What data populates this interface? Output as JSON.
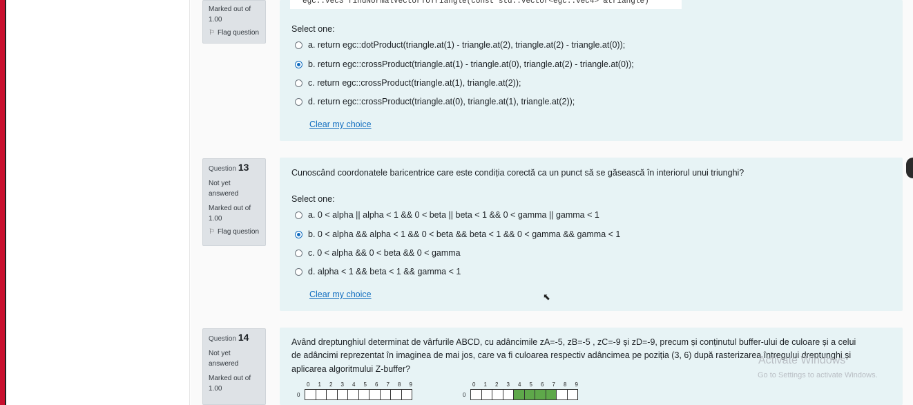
{
  "q12": {
    "marked_label": "Marked out of",
    "marked_value": "1.00",
    "flag_label": "Flag question",
    "code_snippet": "egc::vec3 findNormalVectorToTriangle(const std::vector<egc::vec4> &triangle)",
    "select_one": "Select one:",
    "options": [
      {
        "text": "a. return egc::dotProduct(triangle.at(1) - triangle.at(2), triangle.at(2) - triangle.at(0));",
        "checked": false
      },
      {
        "text": "b. return egc::crossProduct(triangle.at(1) - triangle.at(0), triangle.at(2) - triangle.at(0));",
        "checked": true
      },
      {
        "text": "c. return egc::crossProduct(triangle.at(1), triangle.at(2));",
        "checked": false
      },
      {
        "text": "d. return egc::crossProduct(triangle.at(0), triangle.at(1), triangle.at(2));",
        "checked": false
      }
    ],
    "clear_label": "Clear my choice"
  },
  "q13": {
    "question_word": "Question",
    "number": "13",
    "status_line1": "Not yet",
    "status_line2": "answered",
    "marked_label": "Marked out of",
    "marked_value": "1.00",
    "flag_label": "Flag question",
    "text": "Cunoscând coordonatele baricentrice care este condiția corectă ca un punct să se găsească în interiorul unui triunghi?",
    "select_one": "Select one:",
    "options": [
      {
        "text": "a. 0 < alpha  || alpha < 1 && 0 < beta || beta < 1 && 0 < gamma || gamma < 1",
        "checked": false
      },
      {
        "text": "b. 0 < alpha  && alpha < 1 && 0 < beta && beta < 1 && 0 < gamma && gamma < 1",
        "checked": true
      },
      {
        "text": "c. 0 < alpha  && 0 < beta && 0 < gamma",
        "checked": false
      },
      {
        "text": "d. alpha < 1 && beta < 1 && gamma < 1",
        "checked": false
      }
    ],
    "clear_label": "Clear my choice"
  },
  "q14": {
    "question_word": "Question",
    "number": "14",
    "status_line1": "Not yet",
    "status_line2": "answered",
    "marked_label": "Marked out of",
    "marked_value": "1.00",
    "text_line1": "Având dreptunghiul determinat de vârfurile ABCD, cu adâncimile zA=-5, zB=-5 , zC=-9 și zD=-9, precum și conținutul buffer-ului de culoare și a celui",
    "text_line2": "de adâncimi reprezentat în imaginea de mai jos, care va fi culoarea respectiv adâncimea pe poziția (3, 6) după rasterizarea întregului dreptunghi și",
    "text_line3": "aplicarea algoritmului Z-buffer?",
    "grid_cols": [
      "0",
      "1",
      "2",
      "3",
      "4",
      "5",
      "6",
      "7",
      "8",
      "9"
    ],
    "grid_row_label": "0"
  },
  "watermark": {
    "title": "Activate Windows",
    "subtitle": "Go to Settings to activate Windows."
  },
  "colors": {
    "accent": "#0f6cbf",
    "question_bg": "#e7f3f5",
    "info_bg": "#dee2e6",
    "grid_green": "#5ea84a"
  }
}
